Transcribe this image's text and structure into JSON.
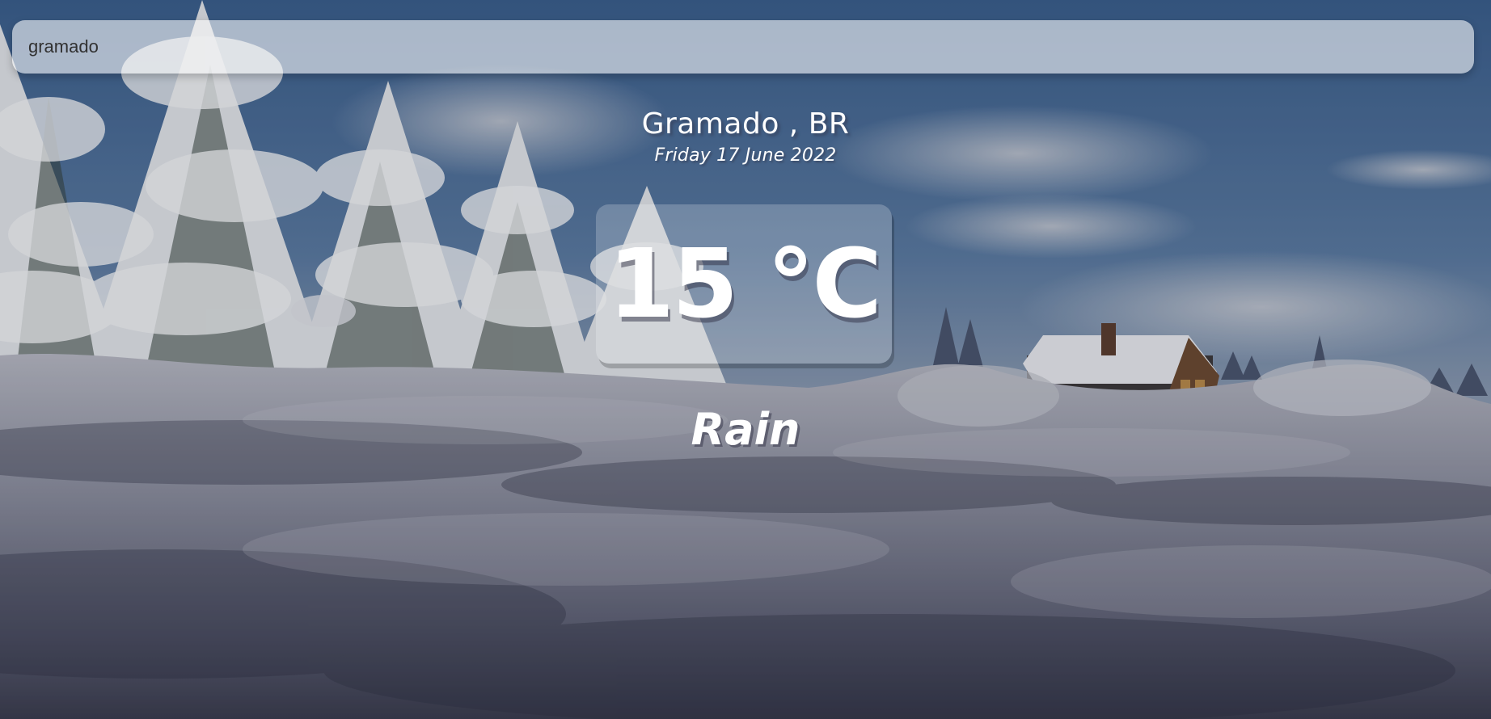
{
  "search": {
    "value": "gramado"
  },
  "location": {
    "name": "Gramado , BR",
    "date": "Friday 17 June 2022"
  },
  "weather": {
    "temperature": "15 °C",
    "description": "Rain"
  },
  "background": {
    "scene": "snowy-forest-cabin",
    "sky_color": "#3f6796",
    "snow_color": "#9a9cac",
    "shadow_color": "#2c3042"
  }
}
